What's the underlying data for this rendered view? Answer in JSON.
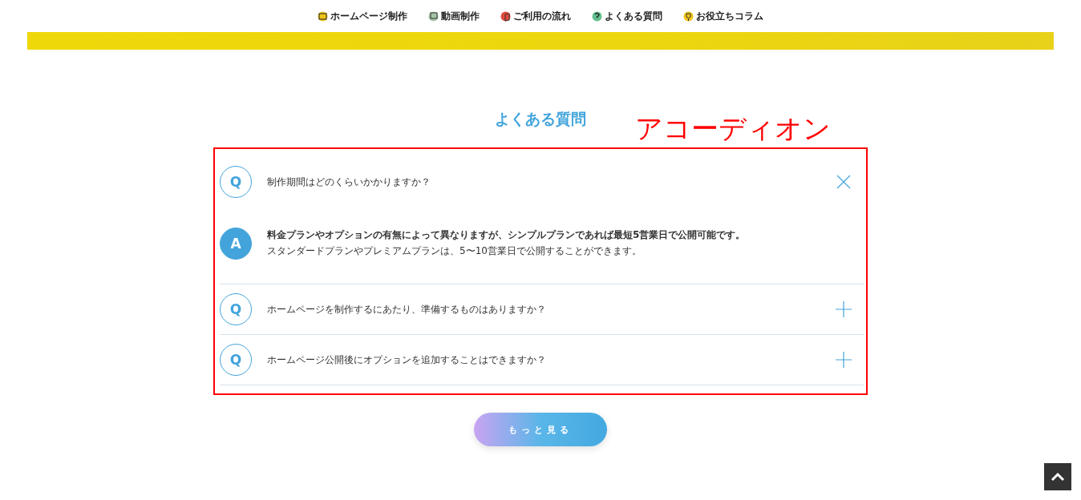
{
  "nav": [
    {
      "label": "ホームページ制作",
      "kind": "image"
    },
    {
      "label": "動画制作",
      "kind": "monitor"
    },
    {
      "label": "ご利用の流れ",
      "kind": "book"
    },
    {
      "label": "よくある質問",
      "kind": "question"
    },
    {
      "label": "お役立ちコラム",
      "kind": "trophy"
    }
  ],
  "heading": "よくある質問",
  "annotation": "アコーディオン",
  "faq": [
    {
      "q_mark": "Q",
      "question": "制作期間はどのくらいかかりますか？",
      "expanded": true,
      "a_mark": "A",
      "answer": [
        "**料金プランやオプションの有無によって異なりますが、シンプルプランであれば最短5営業日で公開可能です。**",
        "スタンダードプランやプレミアムプランは、5〜10営業日で公開することができます。"
      ]
    },
    {
      "q_mark": "Q",
      "question": "ホームページを制作するにあたり、準備するものはありますか？",
      "expanded": false
    },
    {
      "q_mark": "Q",
      "question": "ホームページ公開後にオプションを追加することはできますか？",
      "expanded": false
    }
  ],
  "more_button": "もっと見る"
}
